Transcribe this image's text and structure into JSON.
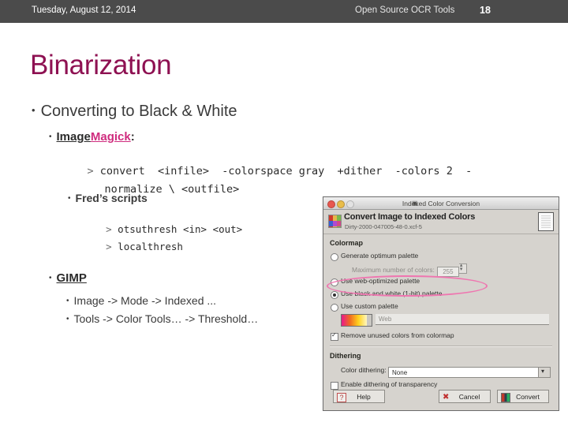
{
  "header": {
    "date": "Tuesday, August 12, 2014",
    "deck_title": "Open Source OCR Tools",
    "page_number": "18"
  },
  "title": "Binarization",
  "bullets": {
    "level1": "Converting to Black & White",
    "imagemagick": {
      "label_a": "Image",
      "label_b": "Magick",
      "colon": ":",
      "code_prompt": ">",
      "code_line1": "convert  <infile>  -colorspace gray  +dither  -colors 2  -",
      "code_line2": "normalize \\ <outfile>",
      "fred": {
        "label": "Fred’s scripts",
        "cmd1_prompt": ">",
        "cmd1": "otsuthresh <in> <out>",
        "cmd2_prompt": ">",
        "cmd2": "localthresh"
      }
    },
    "gimp": {
      "label": "GIMP",
      "step1": "Image -> Mode -> Indexed ...",
      "step2": "Tools -> Color Tools… -> Threshold…"
    }
  },
  "screenshot": {
    "window_title": "Indexed Color Conversion",
    "heading": "Convert Image to Indexed Colors",
    "subheading": "Dirty-2000-047005-48-0.xcf-5",
    "colormap": {
      "group": "Colormap",
      "opt_optimum": "Generate optimum palette",
      "max_colors_label": "Maximum number of colors:",
      "max_colors_value": "255",
      "opt_web": "Use web-optimized palette",
      "opt_bw": "Use black and white (1-bit) palette",
      "opt_custom": "Use custom palette",
      "custom_palette_value": "Web",
      "remove_unused": "Remove unused colors from colormap"
    },
    "dithering": {
      "group": "Dithering",
      "color_dither_label": "Color dithering:",
      "color_dither_value": "None",
      "enable_transparency": "Enable dithering of transparency"
    },
    "buttons": {
      "help": "Help",
      "cancel": "Cancel",
      "convert": "Convert"
    },
    "highlight_color": "#ef76b0"
  },
  "colors": {
    "header_bg": "#4b4b4b",
    "title": "#8e1152",
    "accent_pink": "#cf2c7e",
    "body_text": "#3a3a3a"
  }
}
